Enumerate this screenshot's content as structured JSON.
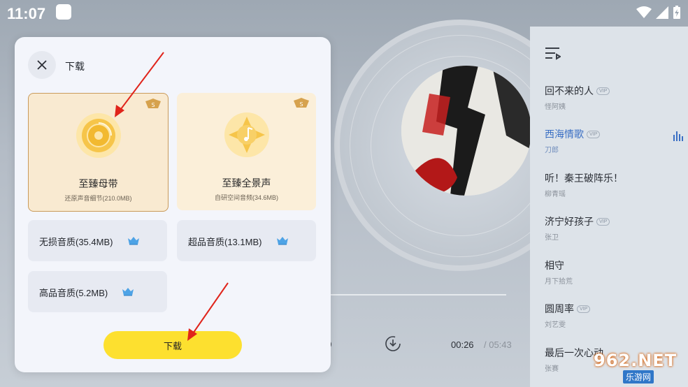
{
  "status_bar": {
    "time": "11:07"
  },
  "dialog": {
    "title": "下载",
    "premium_options": [
      {
        "name": "至臻母带",
        "sub": "还原声音细节(210.0MB)",
        "badge": "S",
        "selected": true,
        "icon": "vinyl-disc-icon"
      },
      {
        "name": "至臻全景声",
        "sub": "自研空间音频(34.6MB)",
        "badge": "S",
        "selected": false,
        "icon": "music-note-icon"
      }
    ],
    "quality_options": [
      {
        "label": "无损音质(35.4MB)",
        "icon": "vip-crown-icon"
      },
      {
        "label": "超品音质(13.1MB)",
        "icon": "vip-crown-icon"
      },
      {
        "label": "高品音质(5.2MB)",
        "icon": "vip-crown-icon"
      }
    ],
    "download_button": "下载"
  },
  "player": {
    "current_time": "00:26",
    "total_time": "/ 05:43"
  },
  "playlist": {
    "items": [
      {
        "title": "回不来的人",
        "artist": "怪阿姨",
        "vip": "VIP",
        "active": false
      },
      {
        "title": "西海情歌",
        "artist": "刀郎",
        "vip": "VIP",
        "active": true
      },
      {
        "title": "听！秦王破阵乐！",
        "artist": "柳青瑶",
        "vip": "",
        "active": false
      },
      {
        "title": "济宁好孩子",
        "artist": "张卫",
        "vip": "VIP",
        "active": false
      },
      {
        "title": "相守",
        "artist": "月下拾荒",
        "vip": "",
        "active": false
      },
      {
        "title": "圆周率",
        "artist": "刘艺雯",
        "vip": "VIP",
        "active": false
      },
      {
        "title": "最后一次心动",
        "artist": "张赛",
        "vip": "",
        "active": false
      }
    ]
  },
  "watermark": {
    "text": "962.NET",
    "sub": "乐游网"
  },
  "colors": {
    "accent_yellow": "#fde02f",
    "active_blue": "#3a6fc4",
    "gold_border": "#c99a5a"
  }
}
